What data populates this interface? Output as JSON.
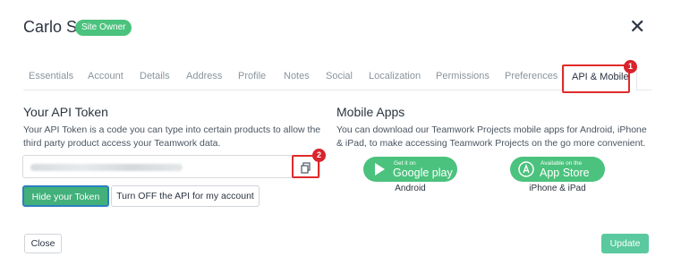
{
  "header": {
    "title": "Carlo S",
    "badge": "Site Owner"
  },
  "tabs": [
    {
      "label": "Essentials"
    },
    {
      "label": "Account"
    },
    {
      "label": "Details"
    },
    {
      "label": "Address"
    },
    {
      "label": "Profile"
    },
    {
      "label": "Notes"
    },
    {
      "label": "Social"
    },
    {
      "label": "Localization"
    },
    {
      "label": "Permissions"
    },
    {
      "label": "Preferences"
    },
    {
      "label": "API & Mobile",
      "active": true
    }
  ],
  "annotations": {
    "marker1": "1",
    "marker2": "2",
    "highlight_color": "#e02b2b"
  },
  "api": {
    "title": "Your API Token",
    "description": "Your API Token is a code you can type into certain products to allow the third party product access your Teamwork data.",
    "hide_button": "Hide your Token",
    "turn_off_button": "Turn OFF the API for my account"
  },
  "mobile": {
    "title": "Mobile Apps",
    "description": "You can download our Teamwork Projects mobile apps for Android, iPhone & iPad, to make accessing Teamwork Projects on the go more convenient.",
    "google": {
      "small": "Get it on",
      "big": "Google play",
      "label": "Android"
    },
    "apple": {
      "small": "Available on the",
      "big": "App Store",
      "label": "iPhone & iPad"
    }
  },
  "footer": {
    "close": "Close",
    "update": "Update"
  },
  "colors": {
    "accent_green": "#4bc27d",
    "primary_button": "#42b07a",
    "update_button": "#5ac9a0"
  }
}
